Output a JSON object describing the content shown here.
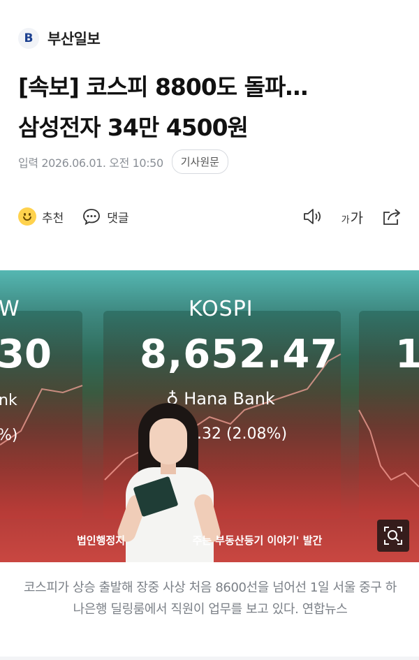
{
  "publisher": {
    "logo_letter": "B",
    "name": "부산일보"
  },
  "article": {
    "headline_line1": "[속보] 코스피 8800도 돌파…",
    "headline_line2": "삼성전자 34만 4500원",
    "date": "입력 2026.06.01. 오전 10:50",
    "original_button": "기사원문"
  },
  "actions": {
    "recommend_label": "추천",
    "comment_label": "댓글",
    "font_small": "가",
    "font_large": "가"
  },
  "photo": {
    "board_left_label": "W",
    "board_left_value": "30",
    "board_left_bank": "nk",
    "board_left_pct": "%)",
    "kospi_label": "KOSPI",
    "kospi_value": "8,652.47",
    "bank_name": "Hana Bank",
    "kospi_change": "6.32 (2.08%)",
    "board_right_value": "1",
    "marquee_left": "법인행정지",
    "marquee_right": "주는 부동산등기 이야기' 발간",
    "caption": "코스피가 상승 출발해 장중 사상 처음 8600선을 넘어선 1일 서울 중구 하나은행 딜링룸에서 직원이 업무를 보고 있다. 연합뉴스"
  },
  "colors": {
    "accent_blue": "#1b3f8f",
    "board_red": "#c94741",
    "board_teal": "#55b7b2"
  }
}
